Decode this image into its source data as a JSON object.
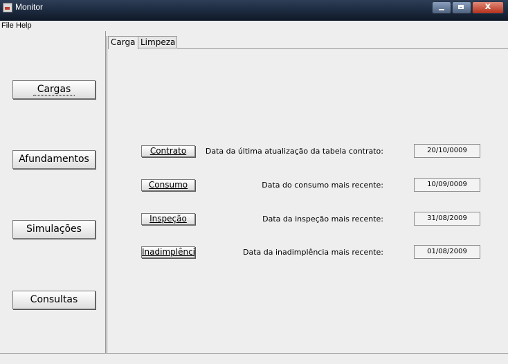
{
  "window": {
    "title": "Monitor"
  },
  "menu": {
    "file": "File",
    "help": "Help"
  },
  "sidebar": {
    "buttons": [
      {
        "label": "Cargas"
      },
      {
        "label": "Afundamentos"
      },
      {
        "label": "Simulações"
      },
      {
        "label": "Consultas"
      }
    ]
  },
  "tabs": [
    {
      "label": "Carga",
      "active": true
    },
    {
      "label": "Limpeza",
      "active": false
    }
  ],
  "rows": [
    {
      "button": "Contrato",
      "label": "Data da última atualização da tabela contrato:",
      "value": "20/10/0009"
    },
    {
      "button": "Consumo",
      "label": "Data do consumo mais recente:",
      "value": "10/09/0009"
    },
    {
      "button": "Inspeção",
      "label": "Data da inspeção mais recente:",
      "value": "31/08/2009"
    },
    {
      "button": "Inadimplência",
      "label": "Data da inadimplência mais recente:",
      "value": "01/08/2009"
    }
  ]
}
